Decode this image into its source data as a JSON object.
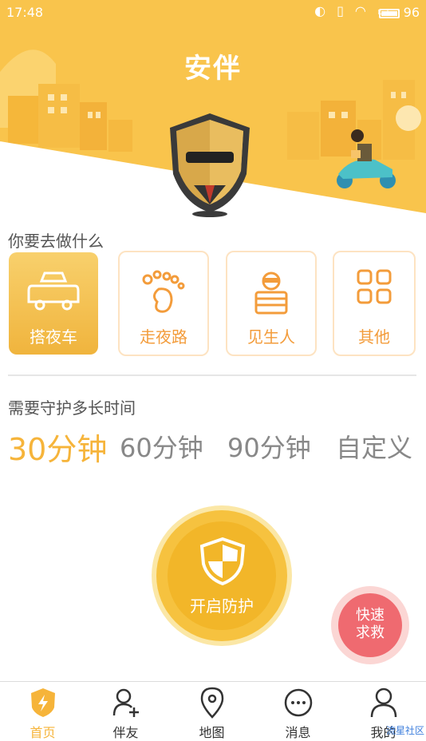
{
  "status_bar": {
    "time": "17:48",
    "battery": "96"
  },
  "header": {
    "title": "安伴"
  },
  "activity": {
    "prompt": "你要去做什么",
    "items": [
      {
        "label": "搭夜车",
        "icon": "taxi-icon",
        "selected": true
      },
      {
        "label": "走夜路",
        "icon": "footprint-icon",
        "selected": false
      },
      {
        "label": "见生人",
        "icon": "stranger-icon",
        "selected": false
      },
      {
        "label": "其他",
        "icon": "grid-icon",
        "selected": false
      }
    ]
  },
  "duration": {
    "prompt": "需要守护多长时间",
    "options": [
      "30分钟",
      "60分钟",
      "90分钟",
      "自定义"
    ],
    "selected": "30分钟"
  },
  "start_button": {
    "label": "开启防护",
    "icon": "shield-icon"
  },
  "sos_button": {
    "line1": "快速",
    "line2": "求救"
  },
  "nav": {
    "items": [
      {
        "label": "首页",
        "icon": "home-bolt-icon",
        "active": true
      },
      {
        "label": "伴友",
        "icon": "add-friend-icon",
        "active": false
      },
      {
        "label": "地图",
        "icon": "map-pin-icon",
        "active": false
      },
      {
        "label": "消息",
        "icon": "message-icon",
        "active": false
      },
      {
        "label": "我的",
        "icon": "profile-icon",
        "active": false
      }
    ]
  },
  "watermark": "流星社区",
  "colors": {
    "accent": "#f6b43a",
    "header_bg": "#f9c44c",
    "sos": "#ef6a70"
  }
}
